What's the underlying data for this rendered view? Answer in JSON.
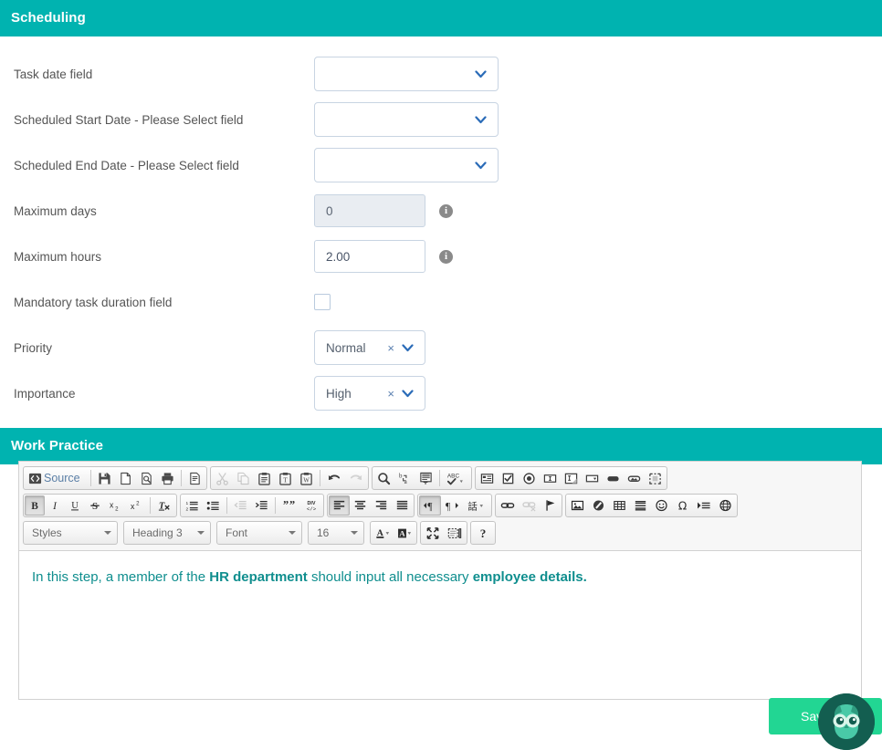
{
  "theme": {
    "section_header_bg": "#00b3b0",
    "save_button_bg": "#22d693",
    "editor_text_color": "#0f8e8e",
    "select_border": "#c8d4e2",
    "chevron_color": "#2b6cb8"
  },
  "scheduling": {
    "title": "Scheduling",
    "rows": [
      {
        "label": "Task date field",
        "type": "select",
        "value": ""
      },
      {
        "label": "Scheduled Start Date - Please Select field",
        "type": "select",
        "value": ""
      },
      {
        "label": "Scheduled End Date - Please Select field",
        "type": "select",
        "value": ""
      },
      {
        "label": "Maximum days",
        "type": "text",
        "value": "0",
        "disabled": true,
        "info": true
      },
      {
        "label": "Maximum hours",
        "type": "text",
        "value": "2.00",
        "disabled": false,
        "info": true
      },
      {
        "label": "Mandatory task duration field",
        "type": "checkbox",
        "checked": false
      },
      {
        "label": "Priority",
        "type": "select-clearable",
        "value": "Normal"
      },
      {
        "label": "Importance",
        "type": "select-clearable",
        "value": "High"
      }
    ],
    "clear_symbol": "×"
  },
  "work_practice": {
    "title": "Work Practice",
    "editor": {
      "toolbar_rows": [
        {
          "groups": [
            {
              "buttons": [
                {
                  "name": "source-icon",
                  "label": "Source"
                },
                {
                  "name": "separator"
                },
                {
                  "name": "save-icon"
                },
                {
                  "name": "new-page-icon"
                },
                {
                  "name": "preview-icon"
                },
                {
                  "name": "print-icon"
                },
                {
                  "name": "separator"
                },
                {
                  "name": "templates-icon"
                }
              ]
            },
            {
              "buttons": [
                {
                  "name": "cut-icon",
                  "disabled": true
                },
                {
                  "name": "copy-icon",
                  "disabled": true
                },
                {
                  "name": "paste-icon"
                },
                {
                  "name": "paste-text-icon"
                },
                {
                  "name": "paste-word-icon"
                },
                {
                  "name": "separator"
                },
                {
                  "name": "undo-icon"
                },
                {
                  "name": "redo-icon",
                  "disabled": true
                }
              ]
            },
            {
              "buttons": [
                {
                  "name": "find-icon"
                },
                {
                  "name": "replace-icon"
                },
                {
                  "name": "select-all-icon"
                },
                {
                  "name": "separator"
                },
                {
                  "name": "spellcheck-icon",
                  "dropdown": true
                }
              ]
            },
            {
              "buttons": [
                {
                  "name": "form-icon"
                },
                {
                  "name": "checkbox-icon"
                },
                {
                  "name": "radio-icon"
                },
                {
                  "name": "text-field-icon"
                },
                {
                  "name": "textarea-icon"
                },
                {
                  "name": "select-field-icon"
                },
                {
                  "name": "button-icon"
                },
                {
                  "name": "image-button-icon"
                },
                {
                  "name": "hidden-field-icon"
                }
              ]
            }
          ]
        },
        {
          "groups": [
            {
              "buttons": [
                {
                  "name": "bold-icon",
                  "active": true
                },
                {
                  "name": "italic-icon"
                },
                {
                  "name": "underline-icon"
                },
                {
                  "name": "strikethrough-icon"
                },
                {
                  "name": "subscript-icon"
                },
                {
                  "name": "superscript-icon"
                },
                {
                  "name": "separator"
                },
                {
                  "name": "remove-format-icon"
                }
              ]
            },
            {
              "buttons": [
                {
                  "name": "numbered-list-icon"
                },
                {
                  "name": "bulleted-list-icon"
                },
                {
                  "name": "separator"
                },
                {
                  "name": "outdent-icon",
                  "disabled": true
                },
                {
                  "name": "indent-icon"
                },
                {
                  "name": "separator"
                },
                {
                  "name": "blockquote-icon"
                },
                {
                  "name": "create-div-icon"
                }
              ]
            },
            {
              "buttons": [
                {
                  "name": "align-left-icon",
                  "active": true
                },
                {
                  "name": "align-center-icon"
                },
                {
                  "name": "align-right-icon"
                },
                {
                  "name": "align-justify-icon"
                }
              ]
            },
            {
              "buttons": [
                {
                  "name": "text-direction-ltr-icon",
                  "active": true
                },
                {
                  "name": "text-direction-rtl-icon"
                },
                {
                  "name": "language-icon",
                  "dropdown": true
                }
              ]
            },
            {
              "buttons": [
                {
                  "name": "link-icon"
                },
                {
                  "name": "unlink-icon",
                  "disabled": true
                },
                {
                  "name": "anchor-icon"
                }
              ]
            },
            {
              "buttons": [
                {
                  "name": "image-icon"
                },
                {
                  "name": "flash-icon"
                },
                {
                  "name": "table-icon"
                },
                {
                  "name": "horizontal-rule-icon"
                },
                {
                  "name": "smiley-icon"
                },
                {
                  "name": "special-char-icon"
                },
                {
                  "name": "page-break-icon"
                },
                {
                  "name": "iframe-icon"
                }
              ]
            }
          ]
        }
      ],
      "combos": [
        {
          "name": "styles-combo",
          "value": "Styles"
        },
        {
          "name": "format-combo",
          "value": "Heading 3"
        },
        {
          "name": "font-combo",
          "value": "Font"
        },
        {
          "name": "font-size-combo",
          "value": "16"
        }
      ],
      "color_buttons": [
        {
          "name": "text-color-icon",
          "glyph": "A"
        },
        {
          "name": "bg-color-icon",
          "glyph": "A"
        }
      ],
      "tool_buttons": [
        {
          "name": "maximize-icon"
        },
        {
          "name": "show-blocks-icon"
        }
      ],
      "about_button": {
        "name": "about-icon",
        "glyph": "?"
      },
      "content": {
        "parts": [
          {
            "text": "In this step, a member of the ",
            "bold": false
          },
          {
            "text": "HR department",
            "bold": true
          },
          {
            "text": " should input all necessary ",
            "bold": false
          },
          {
            "text": "employee details.",
            "bold": true
          }
        ]
      }
    }
  },
  "footer": {
    "save_label": "Save",
    "assistant_icon": "owl-mascot-icon"
  }
}
